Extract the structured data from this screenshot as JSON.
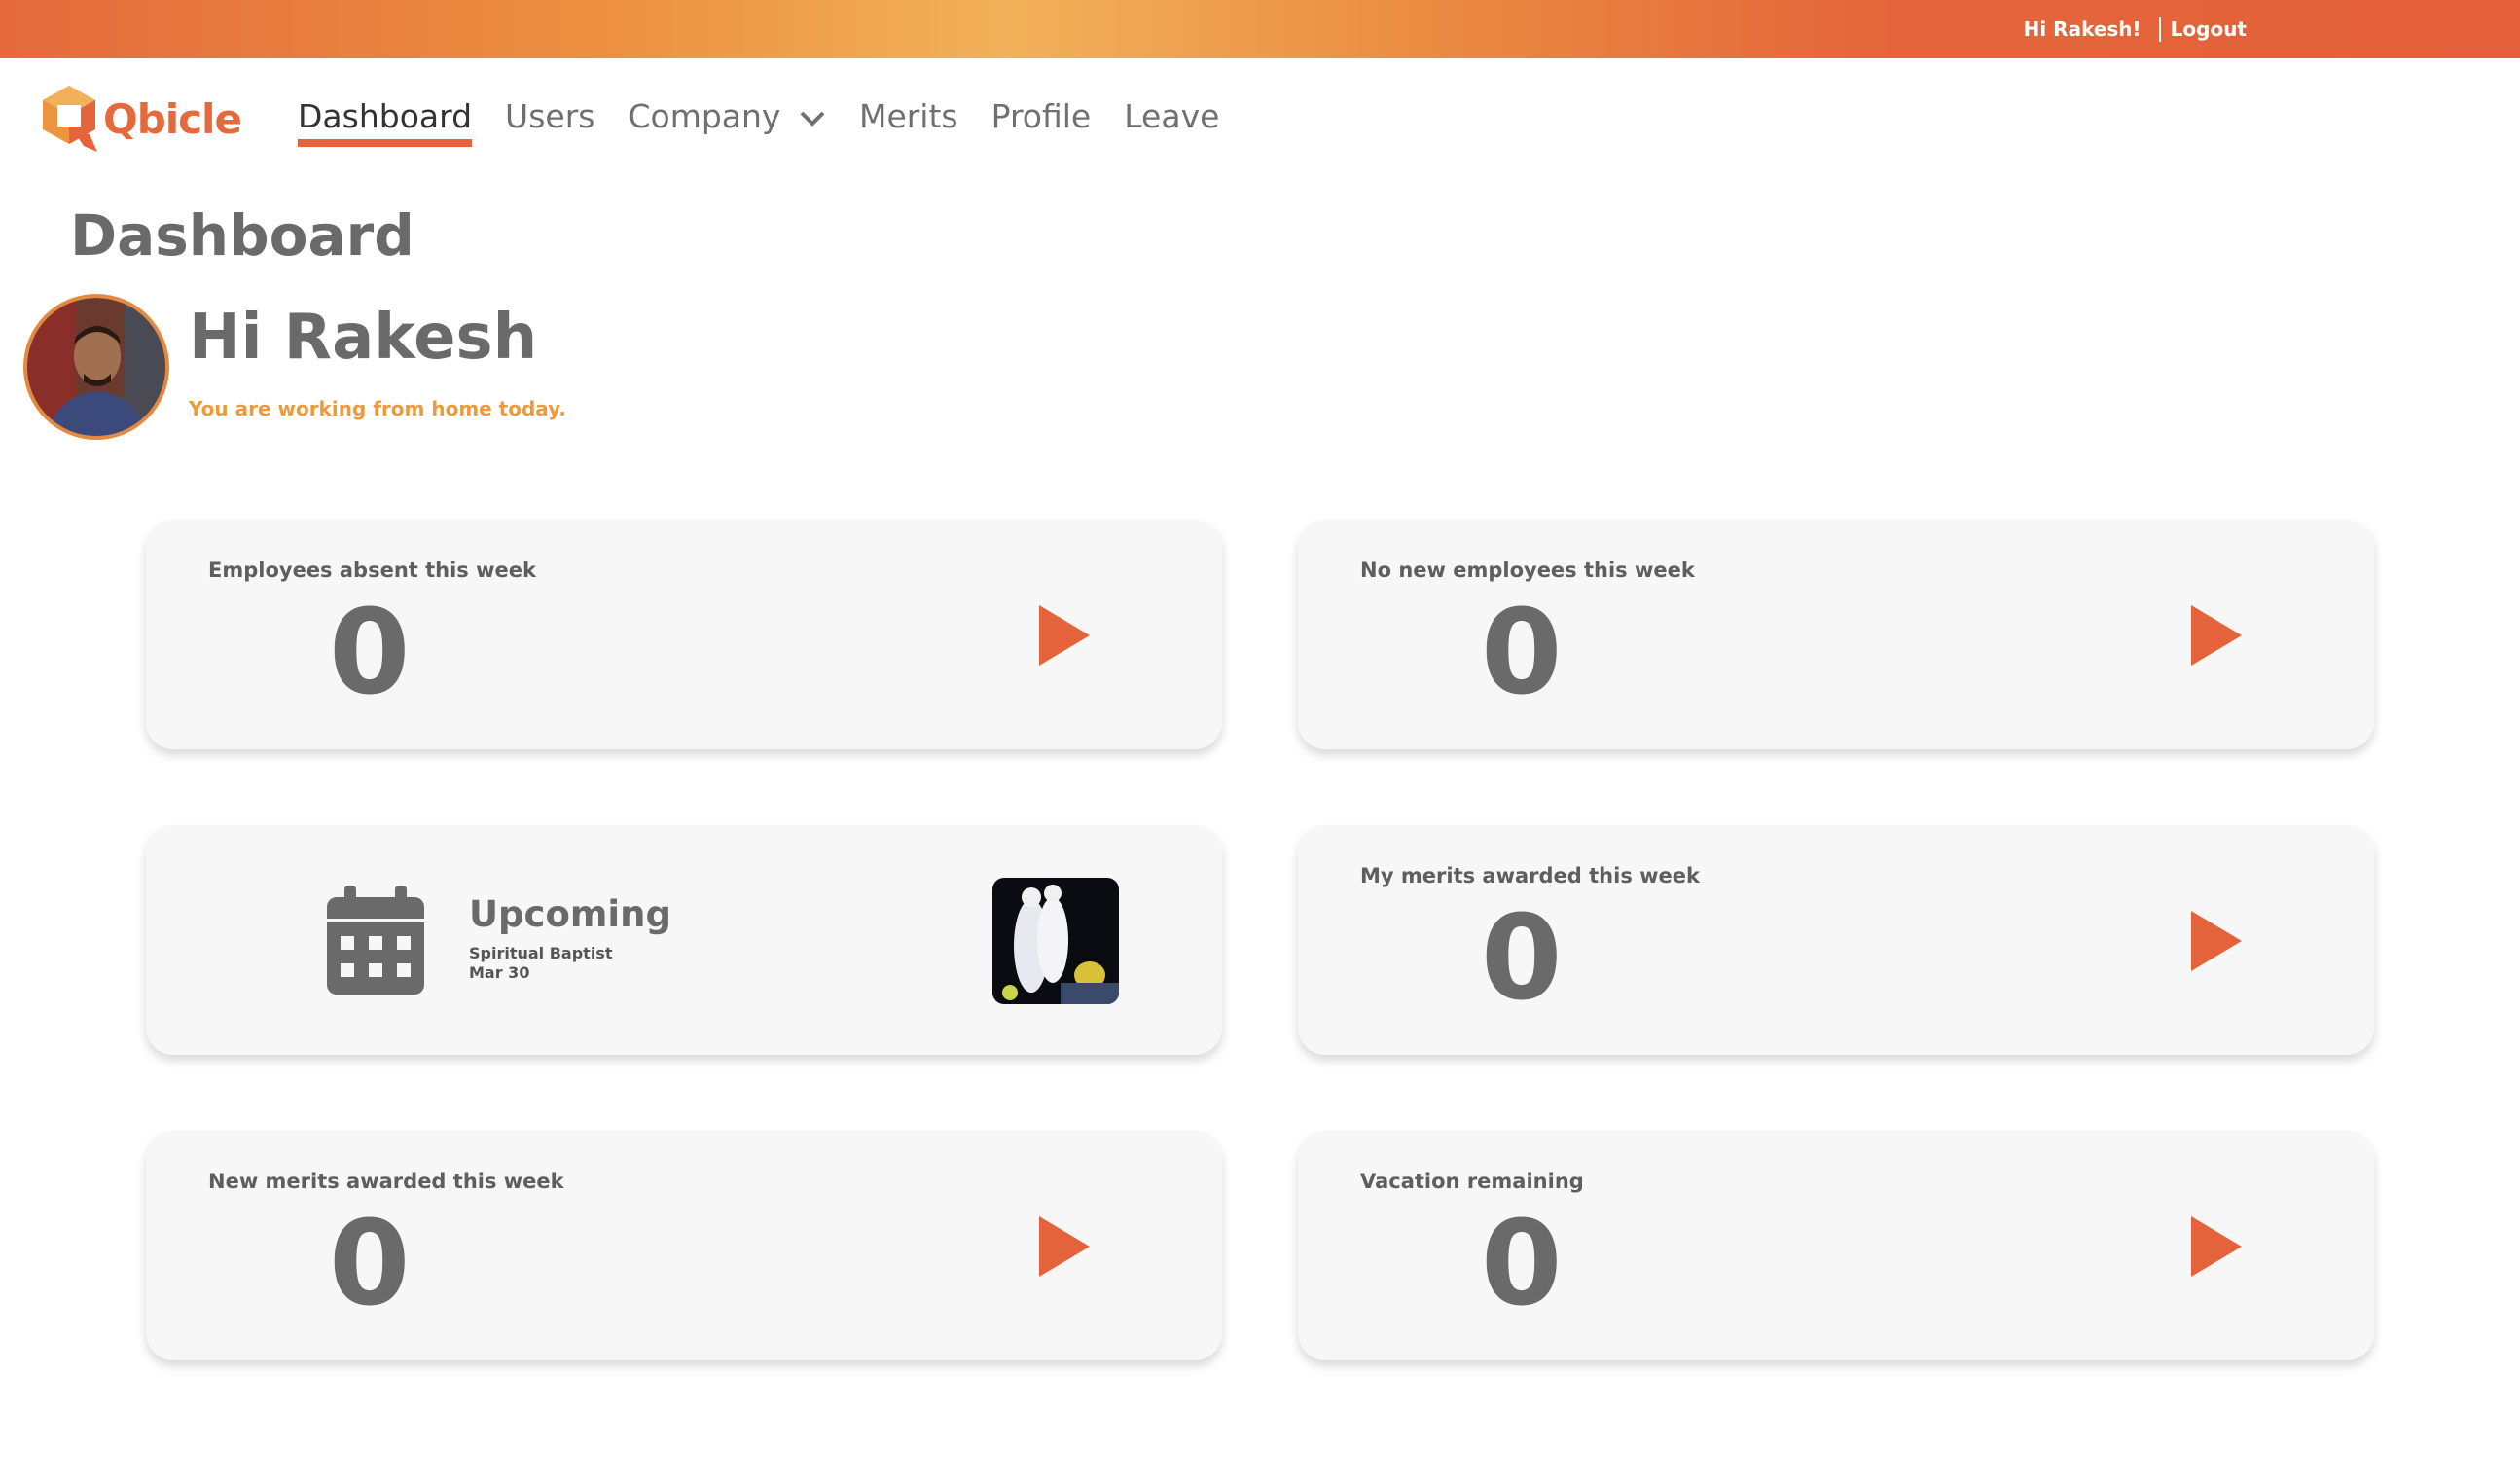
{
  "topbar": {
    "greeting": "Hi Rakesh!",
    "logout": "Logout"
  },
  "brand": {
    "name": "Qbicle"
  },
  "nav": {
    "items": [
      {
        "label": "Dashboard",
        "active": true
      },
      {
        "label": "Users"
      },
      {
        "label": "Company",
        "has_dropdown": true
      },
      {
        "label": "Merits"
      },
      {
        "label": "Profile"
      },
      {
        "label": "Leave"
      }
    ]
  },
  "page": {
    "title": "Dashboard"
  },
  "user": {
    "greeting": "Hi Rakesh",
    "status": "You are working from home today."
  },
  "cards": {
    "absent": {
      "label": "Employees absent this week",
      "value": "0"
    },
    "new_employees": {
      "label": "No new employees this week",
      "value": "0"
    },
    "upcoming": {
      "title": "Upcoming",
      "event": "Spiritual Baptist",
      "date": "Mar 30"
    },
    "my_merits": {
      "label": "My merits awarded this week",
      "value": "0"
    },
    "new_merits": {
      "label": "New merits awarded this week",
      "value": "0"
    },
    "vacation": {
      "label": "Vacation remaining",
      "value": "0"
    }
  },
  "colors": {
    "accent": "#e4633a",
    "status": "#ec9a3c",
    "text": "#6a6a6a"
  }
}
